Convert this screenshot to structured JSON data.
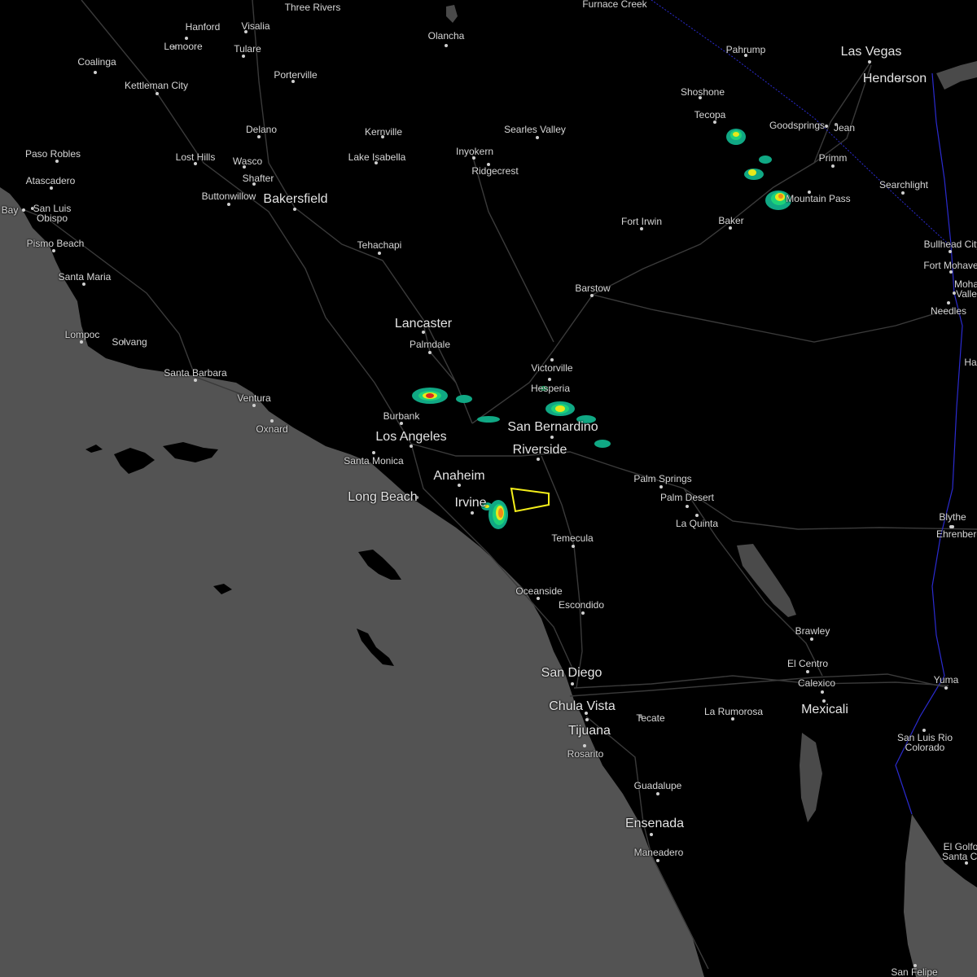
{
  "colors": {
    "land": "#000000",
    "ocean": "#535353",
    "lake": "#4a4a4a",
    "road": "#3a3a3a",
    "border": "#2b2bd0",
    "label": "#d6d6d6",
    "warning_polygon": "#f5ef1a"
  },
  "radar_colors": [
    "#10a884",
    "#1ed27a",
    "#e8e81a",
    "#f08a18",
    "#d82a20"
  ],
  "cities": [
    {
      "name": "Furnace Creek",
      "size": "small"
    },
    {
      "name": "Three Rivers",
      "size": "small"
    },
    {
      "name": "Hanford",
      "size": "small"
    },
    {
      "name": "Visalia",
      "size": "small"
    },
    {
      "name": "Lemoore",
      "size": "small"
    },
    {
      "name": "Tulare",
      "size": "small"
    },
    {
      "name": "Olancha",
      "size": "small"
    },
    {
      "name": "Pahrump",
      "size": "small"
    },
    {
      "name": "Las Vegas",
      "size": "large"
    },
    {
      "name": "Henderson",
      "size": "large"
    },
    {
      "name": "Coalinga",
      "size": "small"
    },
    {
      "name": "Kettleman City",
      "size": "small"
    },
    {
      "name": "Porterville",
      "size": "small"
    },
    {
      "name": "Shoshone",
      "size": "small"
    },
    {
      "name": "Tecopa",
      "size": "small"
    },
    {
      "name": "Goodsprings",
      "size": "small"
    },
    {
      "name": "Jean",
      "size": "small"
    },
    {
      "name": "Delano",
      "size": "small"
    },
    {
      "name": "Kernville",
      "size": "small"
    },
    {
      "name": "Searles Valley",
      "size": "small"
    },
    {
      "name": "Paso Robles",
      "size": "small"
    },
    {
      "name": "Lost Hills",
      "size": "small"
    },
    {
      "name": "Wasco",
      "size": "small"
    },
    {
      "name": "Inyokern",
      "size": "small"
    },
    {
      "name": "Lake Isabella",
      "size": "small"
    },
    {
      "name": "Primm",
      "size": "small"
    },
    {
      "name": "Ridgecrest",
      "size": "small"
    },
    {
      "name": "Shafter",
      "size": "small"
    },
    {
      "name": "Atascadero",
      "size": "small"
    },
    {
      "name": "Searchlight",
      "size": "small"
    },
    {
      "name": "Buttonwillow",
      "size": "small"
    },
    {
      "name": "Bakersfield",
      "size": "large"
    },
    {
      "name": "Mountain Pass",
      "size": "small"
    },
    {
      "name": "San Luis Obispo",
      "size": "small"
    },
    {
      "name": "Bay",
      "size": "small"
    },
    {
      "name": "Fort Irwin",
      "size": "small"
    },
    {
      "name": "Baker",
      "size": "small"
    },
    {
      "name": "Pismo Beach",
      "size": "small"
    },
    {
      "name": "Bullhead City",
      "size": "small"
    },
    {
      "name": "Tehachapi",
      "size": "small"
    },
    {
      "name": "Fort Mohave",
      "size": "small"
    },
    {
      "name": "Santa Maria",
      "size": "small"
    },
    {
      "name": "Mohave Valley",
      "size": "small"
    },
    {
      "name": "Barstow",
      "size": "small"
    },
    {
      "name": "Needles",
      "size": "small"
    },
    {
      "name": "Lancaster",
      "size": "large"
    },
    {
      "name": "Lompoc",
      "size": "small"
    },
    {
      "name": "Solvang",
      "size": "small"
    },
    {
      "name": "Palmdale",
      "size": "small"
    },
    {
      "name": "Victorville",
      "size": "small"
    },
    {
      "name": "Santa Barbara",
      "size": "small"
    },
    {
      "name": "Hesperia",
      "size": "small"
    },
    {
      "name": "Ventura",
      "size": "small"
    },
    {
      "name": "Burbank",
      "size": "small"
    },
    {
      "name": "Oxnard",
      "size": "small"
    },
    {
      "name": "San Bernardino",
      "size": "large"
    },
    {
      "name": "Los Angeles",
      "size": "large"
    },
    {
      "name": "Riverside",
      "size": "large"
    },
    {
      "name": "Santa Monica",
      "size": "small"
    },
    {
      "name": "Anaheim",
      "size": "large"
    },
    {
      "name": "Palm Springs",
      "size": "small"
    },
    {
      "name": "Long Beach",
      "size": "large"
    },
    {
      "name": "Palm Desert",
      "size": "small"
    },
    {
      "name": "Irvine",
      "size": "large"
    },
    {
      "name": "Blythe",
      "size": "small"
    },
    {
      "name": "La Quinta",
      "size": "small"
    },
    {
      "name": "Ehrenberg",
      "size": "small"
    },
    {
      "name": "Temecula",
      "size": "small"
    },
    {
      "name": "Oceanside",
      "size": "small"
    },
    {
      "name": "Escondido",
      "size": "small"
    },
    {
      "name": "Brawley",
      "size": "small"
    },
    {
      "name": "El Centro",
      "size": "small"
    },
    {
      "name": "San Diego",
      "size": "large"
    },
    {
      "name": "Yuma",
      "size": "small"
    },
    {
      "name": "Calexico",
      "size": "small"
    },
    {
      "name": "Chula Vista",
      "size": "large"
    },
    {
      "name": "Mexicali",
      "size": "large"
    },
    {
      "name": "La Rumorosa",
      "size": "small"
    },
    {
      "name": "Tecate",
      "size": "small"
    },
    {
      "name": "Tijuana",
      "size": "large"
    },
    {
      "name": "San Luis Rio Colorado",
      "size": "small"
    },
    {
      "name": "Rosarito",
      "size": "small"
    },
    {
      "name": "Guadalupe",
      "size": "small"
    },
    {
      "name": "Ensenada",
      "size": "large"
    },
    {
      "name": "El Golfo de Santa Clara",
      "size": "small"
    },
    {
      "name": "Maneadero",
      "size": "small"
    },
    {
      "name": "San Felipe",
      "size": "small"
    },
    {
      "name": "Ha",
      "size": "small"
    }
  ]
}
